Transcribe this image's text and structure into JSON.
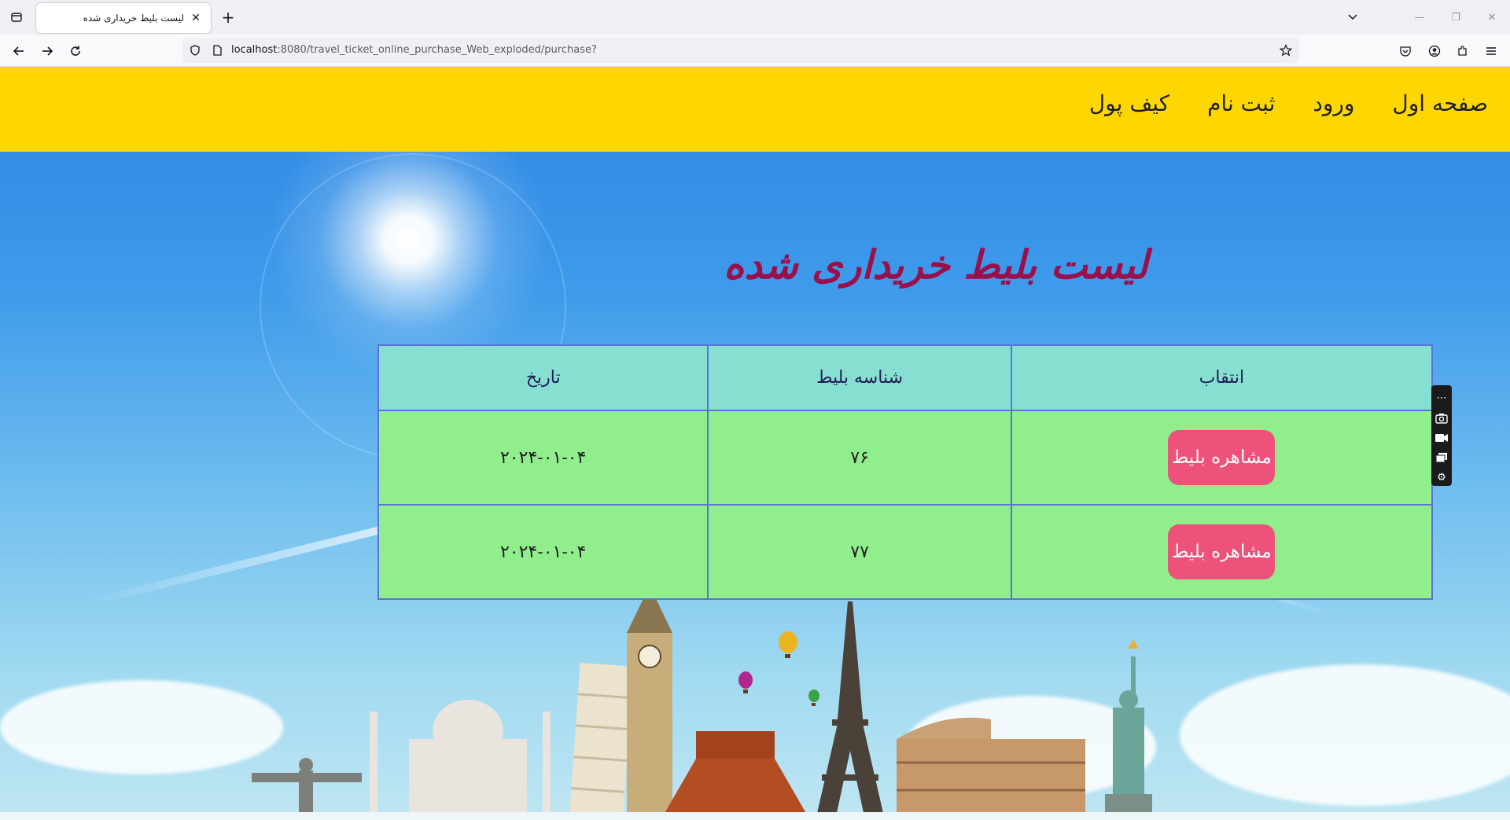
{
  "browser": {
    "tab_title": "لیست بلیط خریداری شده",
    "url_host": "localhost",
    "url_rest": ":8080/travel_ticket_online_purchase_Web_exploded/purchase?"
  },
  "header": {
    "menu": [
      {
        "label": "صفحه اول"
      },
      {
        "label": "ورود"
      },
      {
        "label": "ثبت نام"
      },
      {
        "label": "کیف پول"
      }
    ]
  },
  "main": {
    "title": "لیست بلیط خریداری شده",
    "table": {
      "headers": {
        "select": "انتقاب",
        "ticket_id": "شناسه بلیط",
        "date": "تاریخ"
      },
      "rows": [
        {
          "button": "مشاهره بلیط",
          "ticket_id": "۷۶",
          "date": "۲۰۲۴-۰۱-۰۴"
        },
        {
          "button": "مشاهره بلیط",
          "ticket_id": "۷۷",
          "date": "۲۰۲۴-۰۱-۰۴"
        }
      ]
    }
  },
  "colors": {
    "header_bg": "#fed702",
    "title": "#9b0f4a",
    "table_header_bg": "#86dfd1",
    "table_row_bg": "#90ee8c",
    "table_border": "#5b72d6",
    "button_bg": "#ed527a"
  }
}
